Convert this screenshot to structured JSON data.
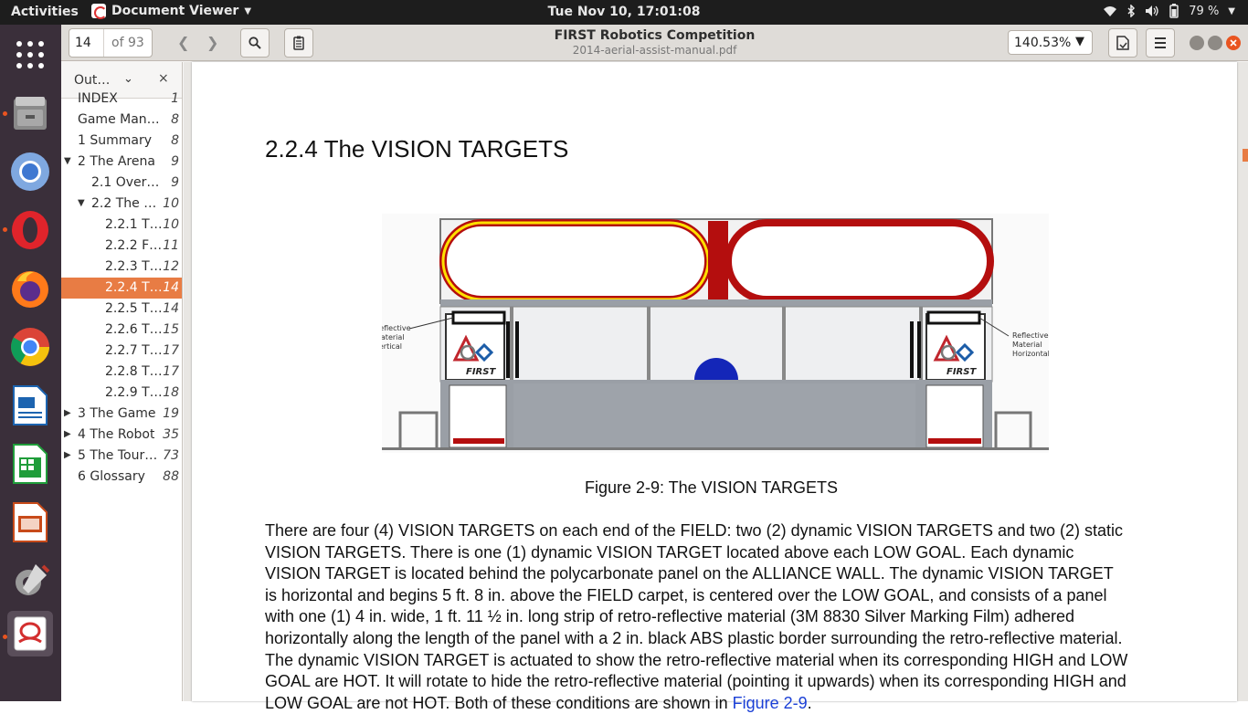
{
  "topbar": {
    "activities": "Activities",
    "app_name": "Document Viewer",
    "clock": "Tue Nov 10, 17:01:08",
    "battery": "79 %"
  },
  "dock": {
    "apps": [
      "files-icon",
      "chromium-icon",
      "opera-icon",
      "firefox-icon",
      "chrome-icon",
      "writer-icon",
      "calc-icon",
      "impress-icon",
      "settings-icon",
      "document-viewer-icon"
    ]
  },
  "toolbar": {
    "page_current": "14",
    "page_total": "of 93",
    "zoom": "140.53%"
  },
  "window": {
    "title": "FIRST Robotics Competition",
    "subtitle": "2014-aerial-assist-manual.pdf"
  },
  "sidebar": {
    "header": "Out…",
    "items": [
      {
        "label": "INDEX",
        "page": "1"
      },
      {
        "label": "Game Man…",
        "page": "8"
      },
      {
        "label": "1 Summary",
        "page": "8"
      },
      {
        "label": "2 The Arena",
        "page": "9"
      },
      {
        "label": "2.1 Over…",
        "page": "9"
      },
      {
        "label": "2.2 The …",
        "page": "10"
      },
      {
        "label": "2.2.1 T…",
        "page": "10"
      },
      {
        "label": "2.2.2 F…",
        "page": "11"
      },
      {
        "label": "2.2.3 T…",
        "page": "12"
      },
      {
        "label": "2.2.4 T…",
        "page": "14"
      },
      {
        "label": "2.2.5 T…",
        "page": "14"
      },
      {
        "label": "2.2.6 T…",
        "page": "15"
      },
      {
        "label": "2.2.7 T…",
        "page": "17"
      },
      {
        "label": "2.2.8 T…",
        "page": "17"
      },
      {
        "label": "2.2.9 T…",
        "page": "18"
      },
      {
        "label": "3 The Game",
        "page": "19"
      },
      {
        "label": "4 The Robot",
        "page": "35"
      },
      {
        "label": "5 The Tour…",
        "page": "73"
      },
      {
        "label": "6 Glossary",
        "page": "88"
      }
    ]
  },
  "document": {
    "heading": "2.2.4 The VISION TARGETS",
    "figure_labels": {
      "left": [
        "Reflective",
        "Material",
        "Vertical"
      ],
      "right": [
        "Reflective",
        "Material",
        "Horizontal"
      ],
      "logo_text": "FIRST"
    },
    "caption": "Figure 2-9: The VISION TARGETS",
    "body_lines": [
      "There are four (4) VISION TARGETS on each end of the FIELD: two (2) dynamic VISION TARGETS and two (2) static",
      "VISION TARGETS. There is one (1) dynamic VISION TARGET located above each LOW GOAL. Each dynamic",
      "VISION TARGET is located behind the polycarbonate panel on the ALLIANCE WALL. The dynamic VISION TARGET",
      "is horizontal and begins 5 ft. 8 in. above the FIELD carpet, is centered over the LOW GOAL, and consists of a panel",
      "with one (1) 4 in. wide, 1 ft. 11 ½ in. long strip of retro-reflective material (3M 8830 Silver Marking Film) adhered",
      "horizontally along the length of the panel with a 2 in. black ABS plastic border surrounding the retro-reflective material.",
      "The dynamic VISION TARGET is actuated to show the retro-reflective material when its corresponding HIGH and LOW",
      "GOAL are HOT. It will rotate to hide the retro-reflective material (pointing it upwards) when its corresponding HIGH and"
    ],
    "last_line_prefix": "LOW GOAL are not HOT. Both of these conditions are shown in ",
    "last_line_link": "Figure 2-9",
    "last_line_suffix": "."
  }
}
